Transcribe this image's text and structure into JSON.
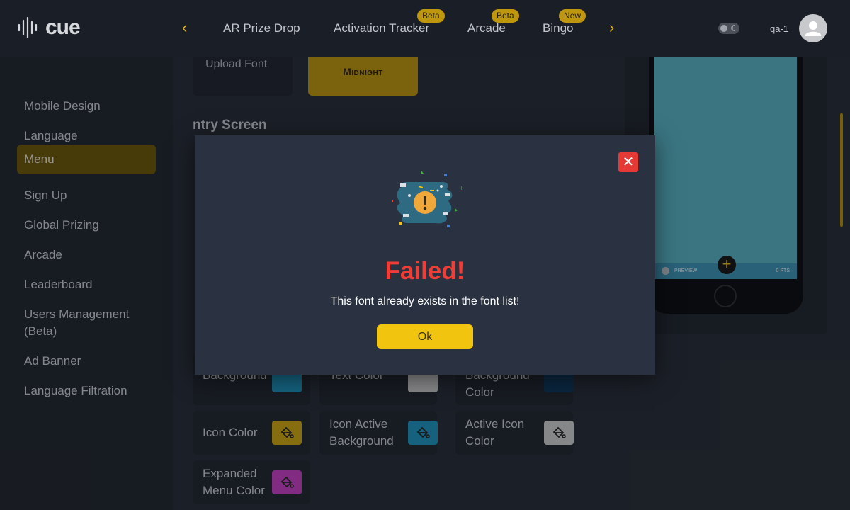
{
  "header": {
    "logo_text": "cue",
    "tabs": [
      {
        "label": "AR Prize Drop",
        "badge": ""
      },
      {
        "label": "Activation Tracker",
        "badge": "Beta"
      },
      {
        "label": "Arcade",
        "badge": "Beta"
      },
      {
        "label": "Bingo",
        "badge": "New"
      }
    ],
    "username": "qa-1",
    "icons": {
      "prev": "chevron-left-icon",
      "next": "chevron-right-icon",
      "theme": "moon-icon",
      "avatar": "user-icon"
    }
  },
  "sidebar": {
    "items": [
      {
        "label": "Mobile Design",
        "active": false
      },
      {
        "label": "Language",
        "active": false
      },
      {
        "label": "Menu",
        "active": true
      },
      {
        "label": "Sign Up",
        "active": false
      },
      {
        "label": "Global Prizing",
        "active": false
      },
      {
        "label": "Arcade",
        "active": false
      },
      {
        "label": "Leaderboard",
        "active": false
      },
      {
        "label": "Users Management (Beta)",
        "active": false
      },
      {
        "label": "Ad Banner",
        "active": false
      },
      {
        "label": "Language Filtration",
        "active": false
      }
    ]
  },
  "main": {
    "upload_font_label": "Upload Font",
    "selected_font": "Midnight",
    "section_title": "ntry Screen",
    "color_cards": [
      {
        "label": "Background",
        "color": "#1c8fb8"
      },
      {
        "label": "Text Color",
        "color": "#c9c9c9"
      },
      {
        "label": "Background Color",
        "color": "#0d3556"
      },
      {
        "label": "Icon Color",
        "color": "#c9a10f"
      },
      {
        "label": "Icon Active Background",
        "color": "#1c8fb8"
      },
      {
        "label": "Active Icon Color",
        "color": "#c9c9c9"
      },
      {
        "label": "Expanded Menu Color",
        "color": "#c23dbf"
      }
    ],
    "preview": {
      "bar_left": "PREVIEW",
      "bar_right": "0 PTS"
    }
  },
  "modal": {
    "title": "Failed!",
    "message": "This font already exists in the font list!",
    "ok_label": "Ok",
    "close_icon": "close-icon",
    "illustration": "warning-illustration-icon"
  },
  "colors": {
    "accent": "#f1c40f",
    "error": "#f03e36",
    "modal_bg": "#2a3242"
  }
}
